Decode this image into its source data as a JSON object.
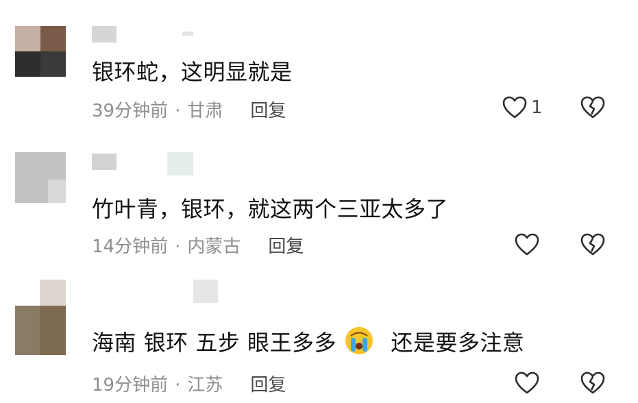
{
  "comments": [
    {
      "avatar_colors": [
        "#b89f94",
        "#7a5a48",
        "#4e4b48",
        "#2b2b2b"
      ],
      "text": "银环蛇，这明显就是",
      "time": "39分钟前",
      "location": "甘肃",
      "reply_label": "回复",
      "like_count": "1",
      "emoji": null
    },
    {
      "avatar_colors": [
        "#c4c4c4",
        "#b8b8b8",
        "#d4d4d4",
        "#bcbcbc"
      ],
      "text": "竹叶青，银环，就这两个三亚太多了",
      "time": "14分钟前",
      "location": "内蒙古",
      "reply_label": "回复",
      "like_count": "",
      "emoji": null
    },
    {
      "avatar_colors": [
        "#ddd6cf",
        "#8a7a66",
        "#7a6242",
        "#8f7550"
      ],
      "text_before": "海南 银环 五步 眼王多多",
      "emoji": "crying-face",
      "text_after": "还是要多注意",
      "time": "19分钟前",
      "location": "江苏",
      "reply_label": "回复",
      "like_count": ""
    }
  ],
  "meta_separator": "·",
  "icons": {
    "like": "heart-outline-icon",
    "dislike": "broken-heart-icon",
    "emoji": "crying-face"
  },
  "colors": {
    "text": "#111111",
    "meta": "#8e8e93",
    "icon": "#2b2b2b"
  }
}
